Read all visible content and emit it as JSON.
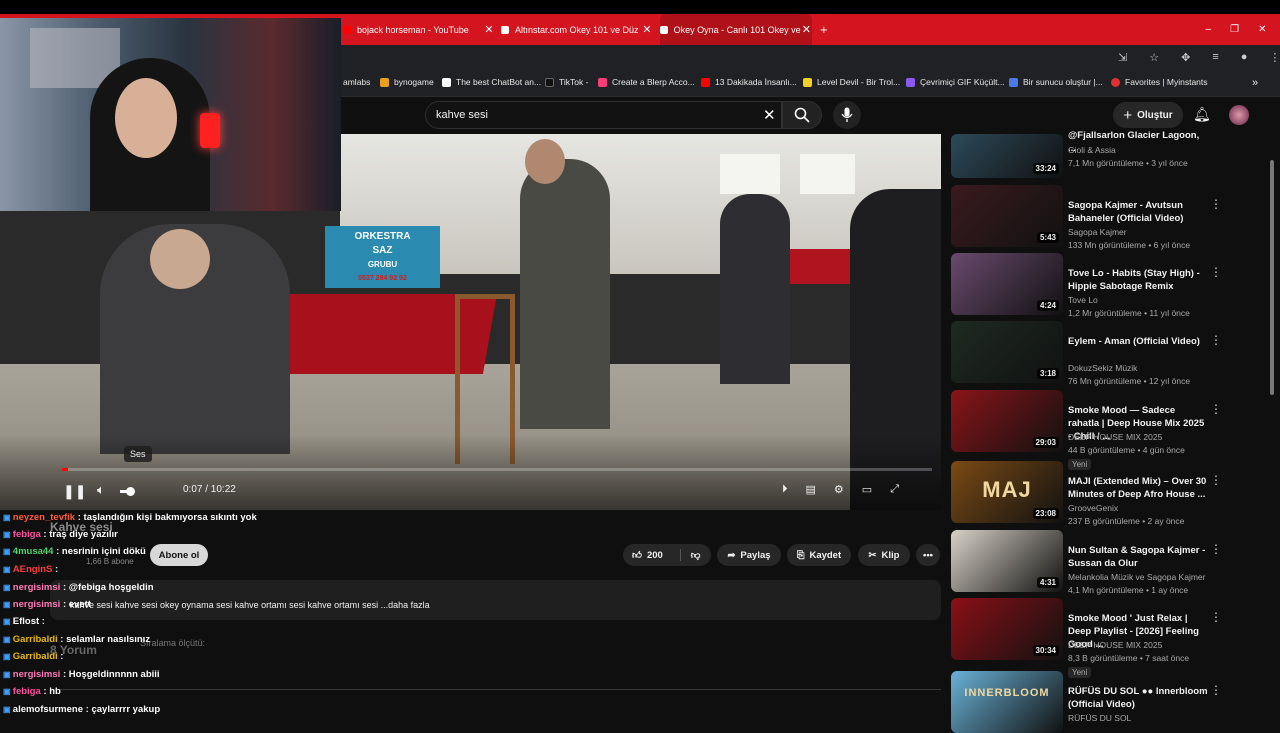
{
  "browser": {
    "tabs": [
      {
        "title": "bojack horseman - YouTube"
      },
      {
        "title": "Altınstar.com Okey 101 ve Düz"
      },
      {
        "title": "Okey Oyna - Canlı 101 Okey ve"
      }
    ],
    "new_tab": "+",
    "bookmarks": [
      "amlabs",
      "bynogame",
      "The best ChatBot an...",
      "TikTok -",
      "Create a Blerp Acco...",
      "13 Dakikada İnsanlı...",
      "Level Devil - Bir Trol...",
      "Çevrimiçi GIF Küçült...",
      "Bir sunucu oluştur |...",
      "Favorites | Myinstants"
    ],
    "colors": {
      "tabbar": "#d4141e",
      "toolbar": "#202124"
    }
  },
  "youtube": {
    "search_value": "kahve sesi",
    "create_label": "Oluştur",
    "player": {
      "tooltip": "Ses",
      "time": "0:07 / 10:22",
      "sign1": "ORKESTRA",
      "sign2": "SAZ",
      "sign3": "GRUBU",
      "sign_phone": "0537 284 92 92"
    },
    "video": {
      "title": "Kahve sesi",
      "channel_subs": "1,66 B abone",
      "subscribe_label": "Abone ol",
      "likes": "200",
      "share": "Paylaş",
      "save": "Kaydet",
      "clip": "Klip",
      "description": "kahve sesi kahve sesi okey oynama sesi kahve ortamı sesi  kahve ortamı sesi ...daha fazla",
      "comments_count": "8 Yorum",
      "sort_label": "Sıralama ölçütü:"
    },
    "recommendations": [
      {
        "title": "@Fjallsarlon Glacier Lagoon, ...",
        "channel": "Gioli & Assia",
        "meta": "7,1 Mn görüntüleme • 3 yıl önce",
        "duration": "33:24",
        "color": "#2c4a5a"
      },
      {
        "title": "Sagopa Kajmer - Avutsun Bahaneler (Official Video)",
        "channel": "Sagopa Kajmer",
        "meta": "133 Mn görüntüleme • 6 yıl önce",
        "duration": "5:43",
        "color": "#3a1a1e"
      },
      {
        "title": "Tove Lo - Habits (Stay High) - Hippie Sabotage Remix",
        "channel": "Tove Lo",
        "meta": "1,2 Mr görüntüleme • 11 yıl önce",
        "duration": "4:24",
        "color": "#6a4a6e"
      },
      {
        "title": "Eylem - Aman (Official Video)",
        "channel": "DokuzSekiz Müzik",
        "meta": "76 Mn görüntüleme • 12 yıl önce",
        "duration": "3:18",
        "color": "#1e2a22"
      },
      {
        "title": "Smoke Mood — Sadece rahatla | Deep House Mix 2025 - Chill / ...",
        "channel": "DEEP HOUSE MIX 2025",
        "meta": "44 B görüntüleme • 4 gün önce",
        "badge": "Yeni",
        "duration": "29:03",
        "color": "#8a1418"
      },
      {
        "title": "MAJI (Extended Mix) – Over 30 Minutes of Deep Afro House ...",
        "channel": "GrooveGenix",
        "meta": "237 B görüntüleme • 2 ay önce",
        "duration": "23:08",
        "color": "#7a4a14",
        "label": "MAJ"
      },
      {
        "title": "Nun Sultan & Sagopa Kajmer - Sussan da Olur",
        "channel": "Melankolia Müzik ve Sagopa Kajmer",
        "meta": "4,1 Mn görüntüleme • 1 ay önce",
        "duration": "4:31",
        "color": "#d8d2c8"
      },
      {
        "title": "Smoke Mood ' Just Relax | Deep Playlist - [2026] Feeling Good ...",
        "channel": "DEEP HOUSE MIX 2025",
        "meta": "8,3 B görüntüleme • 7 saat önce",
        "badge": "Yeni",
        "duration": "30:34",
        "color": "#8a1016"
      },
      {
        "title": "RÜFÜS DU SOL ●● Innerbloom (Official Video)",
        "channel": "RÜFÜS DU SOL",
        "meta": "",
        "duration": "",
        "color": "#6ab2d8",
        "label": "INNERBLOOM"
      }
    ]
  },
  "chat": [
    {
      "user": "neyzen_tevfik",
      "msg": "taşlandığın kişi bakmıyorsa sıkıntı yok",
      "color": "#ff5a3c"
    },
    {
      "user": "febiga",
      "msg": "traş diye yazılır",
      "color": "#ff4fa0"
    },
    {
      "user": "4musa44",
      "msg": "nesrinin içini dökü",
      "color": "#4fd06a"
    },
    {
      "user": "AEnginS",
      "msg": "",
      "color": "#ff3c3c"
    },
    {
      "user": "nergisimsi",
      "msg": "@febiga hoşgeldin",
      "color": "#ff7ab8"
    },
    {
      "user": "nergisimsi",
      "msg": "evett",
      "color": "#ff7ab8"
    },
    {
      "user": "Eflost",
      "msg": "",
      "color": "#ffffff"
    },
    {
      "user": "Garribaldi",
      "msg": "selamlar nasılsınız",
      "color": "#e8b800"
    },
    {
      "user": "Garribaldi",
      "msg": "",
      "color": "#e8b800"
    },
    {
      "user": "nergisimsi",
      "msg": "Hoşgeldinnnnn abiii",
      "color": "#ff7ab8"
    },
    {
      "user": "febiga",
      "msg": "hb",
      "color": "#ff4fa0"
    },
    {
      "user": "alemofsurmene",
      "msg": "çaylarrrr yakup",
      "color": "#ffffff"
    }
  ]
}
